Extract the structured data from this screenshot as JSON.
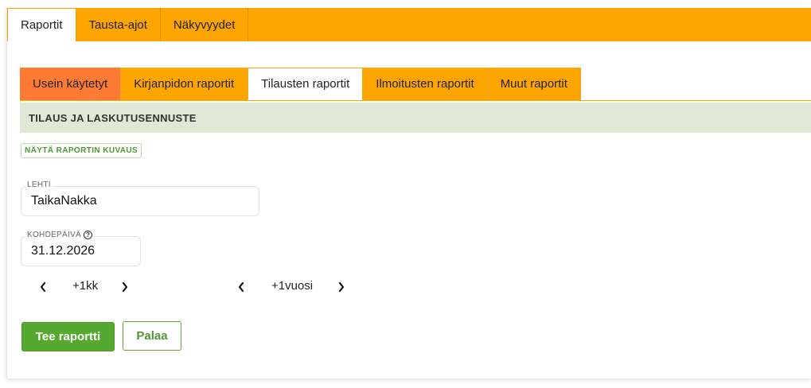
{
  "topnav": {
    "tabs": [
      {
        "label": "Raportit",
        "active": true
      },
      {
        "label": "Tausta-ajot",
        "active": false
      },
      {
        "label": "Näkyvyydet",
        "active": false
      }
    ]
  },
  "subtabs": {
    "tabs": [
      {
        "label": "Usein käytetyt"
      },
      {
        "label": "Kirjanpidon raportit"
      },
      {
        "label": "Tilausten raportit",
        "active": true
      },
      {
        "label": "Ilmoitusten raportit"
      },
      {
        "label": "Muut raportit"
      }
    ]
  },
  "report": {
    "title": "TILAUS JA LASKUTUSENNUSTE",
    "description_button": "NÄYTÄ RAPORTIN KUVAUS"
  },
  "form": {
    "publication": {
      "label": "LEHTI",
      "value": "TaikaNakka"
    },
    "target_date": {
      "label": "KOHDEPÄIVÄ",
      "value": "31.12.2026",
      "help_icon": "question-circle-icon"
    },
    "month_stepper": {
      "label": "+1kk",
      "prev_icon": "chevron-left-icon",
      "next_icon": "chevron-right-icon"
    },
    "year_stepper": {
      "label": "+1vuosi",
      "prev_icon": "chevron-left-icon",
      "next_icon": "chevron-right-icon"
    }
  },
  "actions": {
    "run_label": "Tee raportti",
    "back_label": "Palaa"
  },
  "colors": {
    "orange": "#ffa500",
    "frequent_tab": "#ff7a33",
    "section_bg": "#dfe9d5",
    "green": "#55a830"
  }
}
